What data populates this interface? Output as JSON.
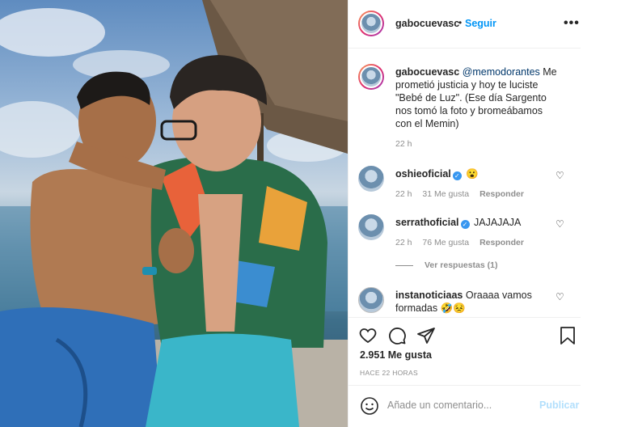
{
  "post": {
    "photo_icon": "photo",
    "username": "gabocuevasc",
    "follow_label": "Seguir",
    "separator": "•",
    "more_icon": "•••",
    "caption": {
      "username": "gabocuevasc",
      "mention": "@memodorantes",
      "text": " Me prometió justicia y hoy te luciste \"Bebé de Luz\". (Ese día Sargento nos tomó la foto y bromeábamos con el Memin)",
      "time": "22 h"
    },
    "comments": [
      {
        "username": "oshieoficial",
        "text": "😮",
        "time": "22 h",
        "likes": "31 Me gusta",
        "reply": "Responder"
      },
      {
        "username": "serrathoficial",
        "text": "JAJAJAJA",
        "time": "22 h",
        "likes": "76 Me gusta",
        "reply": "Responder"
      },
      {
        "username": "instanoticiaas",
        "text": "Oraaaa vamos formadas 🤣😣"
      }
    ],
    "view_replies": "Ver respuestas (1)",
    "likes": "2.951 Me gusta",
    "posted_ago": "HACE 22 HORAS",
    "comment_placeholder": "Añade un comentario...",
    "publish_label": "Publicar",
    "verified_icon": "✓"
  }
}
